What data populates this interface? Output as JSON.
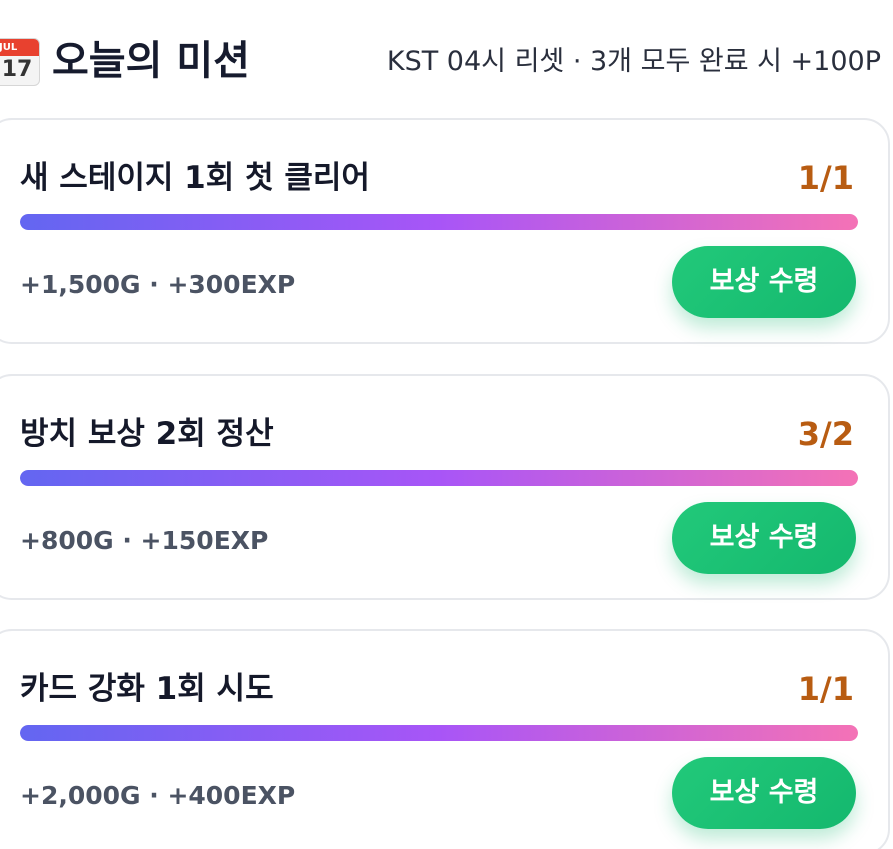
{
  "header": {
    "calendar_icon": {
      "name": "calendar-icon",
      "month": "JUL",
      "day": "17"
    },
    "title": "오늘의 미션",
    "subtitle": "KST 04시 리셋 · 3개 모두 완료 시 +100P"
  },
  "missions": [
    {
      "title": "새 스테이지 1회 첫 클리어",
      "count": "1/1",
      "progress": 1.0,
      "reward": "+1,500G · +300EXP",
      "button_label": "보상 수령"
    },
    {
      "title": "방치 보상 2회 정산",
      "count": "3/2",
      "progress": 1.0,
      "reward": "+800G · +150EXP",
      "button_label": "보상 수령"
    },
    {
      "title": "카드 강화 1회 시도",
      "count": "1/1",
      "progress": 1.0,
      "reward": "+2,000G · +400EXP",
      "button_label": "보상 수령"
    }
  ],
  "colors": {
    "title": "#161b2e",
    "count": "#b85c12",
    "progress_gradient": [
      "#6366f1",
      "#a855f7",
      "#f472b6"
    ],
    "button": "#1dbf74",
    "reward_text": "#4b5363",
    "card_border": "#e6e8ec"
  }
}
